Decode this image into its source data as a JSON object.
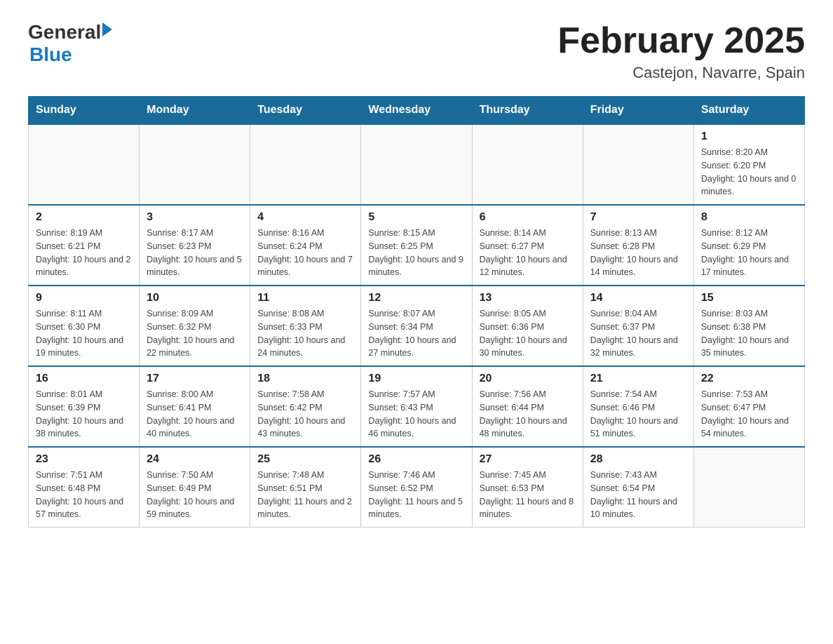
{
  "header": {
    "logo": {
      "general": "General",
      "blue": "Blue",
      "arrow": "▶"
    },
    "title": "February 2025",
    "location": "Castejon, Navarre, Spain"
  },
  "weekdays": [
    "Sunday",
    "Monday",
    "Tuesday",
    "Wednesday",
    "Thursday",
    "Friday",
    "Saturday"
  ],
  "weeks": [
    [
      {
        "day": "",
        "info": ""
      },
      {
        "day": "",
        "info": ""
      },
      {
        "day": "",
        "info": ""
      },
      {
        "day": "",
        "info": ""
      },
      {
        "day": "",
        "info": ""
      },
      {
        "day": "",
        "info": ""
      },
      {
        "day": "1",
        "info": "Sunrise: 8:20 AM\nSunset: 6:20 PM\nDaylight: 10 hours and 0 minutes."
      }
    ],
    [
      {
        "day": "2",
        "info": "Sunrise: 8:19 AM\nSunset: 6:21 PM\nDaylight: 10 hours and 2 minutes."
      },
      {
        "day": "3",
        "info": "Sunrise: 8:17 AM\nSunset: 6:23 PM\nDaylight: 10 hours and 5 minutes."
      },
      {
        "day": "4",
        "info": "Sunrise: 8:16 AM\nSunset: 6:24 PM\nDaylight: 10 hours and 7 minutes."
      },
      {
        "day": "5",
        "info": "Sunrise: 8:15 AM\nSunset: 6:25 PM\nDaylight: 10 hours and 9 minutes."
      },
      {
        "day": "6",
        "info": "Sunrise: 8:14 AM\nSunset: 6:27 PM\nDaylight: 10 hours and 12 minutes."
      },
      {
        "day": "7",
        "info": "Sunrise: 8:13 AM\nSunset: 6:28 PM\nDaylight: 10 hours and 14 minutes."
      },
      {
        "day": "8",
        "info": "Sunrise: 8:12 AM\nSunset: 6:29 PM\nDaylight: 10 hours and 17 minutes."
      }
    ],
    [
      {
        "day": "9",
        "info": "Sunrise: 8:11 AM\nSunset: 6:30 PM\nDaylight: 10 hours and 19 minutes."
      },
      {
        "day": "10",
        "info": "Sunrise: 8:09 AM\nSunset: 6:32 PM\nDaylight: 10 hours and 22 minutes."
      },
      {
        "day": "11",
        "info": "Sunrise: 8:08 AM\nSunset: 6:33 PM\nDaylight: 10 hours and 24 minutes."
      },
      {
        "day": "12",
        "info": "Sunrise: 8:07 AM\nSunset: 6:34 PM\nDaylight: 10 hours and 27 minutes."
      },
      {
        "day": "13",
        "info": "Sunrise: 8:05 AM\nSunset: 6:36 PM\nDaylight: 10 hours and 30 minutes."
      },
      {
        "day": "14",
        "info": "Sunrise: 8:04 AM\nSunset: 6:37 PM\nDaylight: 10 hours and 32 minutes."
      },
      {
        "day": "15",
        "info": "Sunrise: 8:03 AM\nSunset: 6:38 PM\nDaylight: 10 hours and 35 minutes."
      }
    ],
    [
      {
        "day": "16",
        "info": "Sunrise: 8:01 AM\nSunset: 6:39 PM\nDaylight: 10 hours and 38 minutes."
      },
      {
        "day": "17",
        "info": "Sunrise: 8:00 AM\nSunset: 6:41 PM\nDaylight: 10 hours and 40 minutes."
      },
      {
        "day": "18",
        "info": "Sunrise: 7:58 AM\nSunset: 6:42 PM\nDaylight: 10 hours and 43 minutes."
      },
      {
        "day": "19",
        "info": "Sunrise: 7:57 AM\nSunset: 6:43 PM\nDaylight: 10 hours and 46 minutes."
      },
      {
        "day": "20",
        "info": "Sunrise: 7:56 AM\nSunset: 6:44 PM\nDaylight: 10 hours and 48 minutes."
      },
      {
        "day": "21",
        "info": "Sunrise: 7:54 AM\nSunset: 6:46 PM\nDaylight: 10 hours and 51 minutes."
      },
      {
        "day": "22",
        "info": "Sunrise: 7:53 AM\nSunset: 6:47 PM\nDaylight: 10 hours and 54 minutes."
      }
    ],
    [
      {
        "day": "23",
        "info": "Sunrise: 7:51 AM\nSunset: 6:48 PM\nDaylight: 10 hours and 57 minutes."
      },
      {
        "day": "24",
        "info": "Sunrise: 7:50 AM\nSunset: 6:49 PM\nDaylight: 10 hours and 59 minutes."
      },
      {
        "day": "25",
        "info": "Sunrise: 7:48 AM\nSunset: 6:51 PM\nDaylight: 11 hours and 2 minutes."
      },
      {
        "day": "26",
        "info": "Sunrise: 7:46 AM\nSunset: 6:52 PM\nDaylight: 11 hours and 5 minutes."
      },
      {
        "day": "27",
        "info": "Sunrise: 7:45 AM\nSunset: 6:53 PM\nDaylight: 11 hours and 8 minutes."
      },
      {
        "day": "28",
        "info": "Sunrise: 7:43 AM\nSunset: 6:54 PM\nDaylight: 11 hours and 10 minutes."
      },
      {
        "day": "",
        "info": ""
      }
    ]
  ]
}
